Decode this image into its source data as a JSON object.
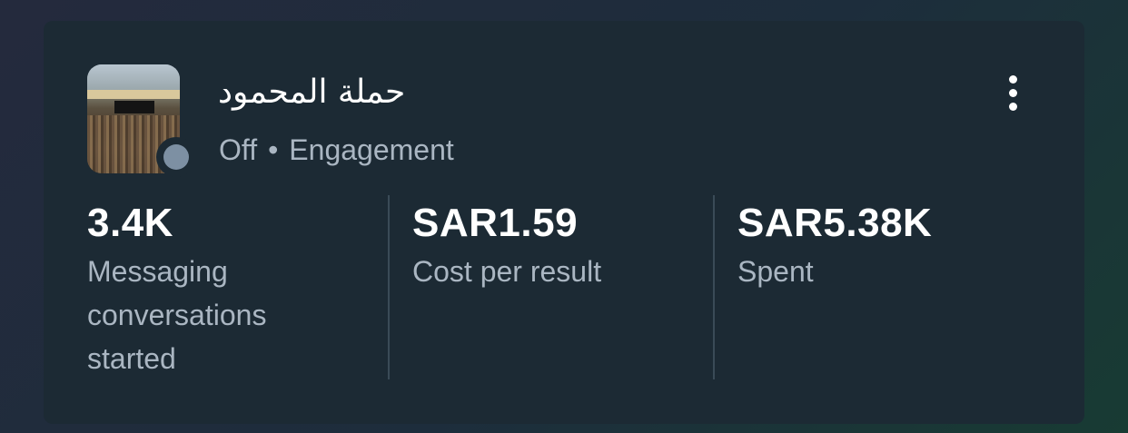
{
  "campaign": {
    "title": "حملة المحمود",
    "status": "Off",
    "separator": "•",
    "objective": "Engagement"
  },
  "metrics": [
    {
      "value": "3.4K",
      "label": "Messaging conversations started"
    },
    {
      "value": "SAR1.59",
      "label": "Cost per result"
    },
    {
      "value": "SAR5.38K",
      "label": "Spent"
    }
  ],
  "icons": {
    "thumbnail": "kaaba-photo",
    "status": "status-dot-off",
    "menu": "more-vertical-icon"
  },
  "colors": {
    "card_bg": "#1c2a34",
    "status_dot": "#7d90a3",
    "secondary_text": "#aab6c2",
    "divider": "#3a4b57"
  }
}
